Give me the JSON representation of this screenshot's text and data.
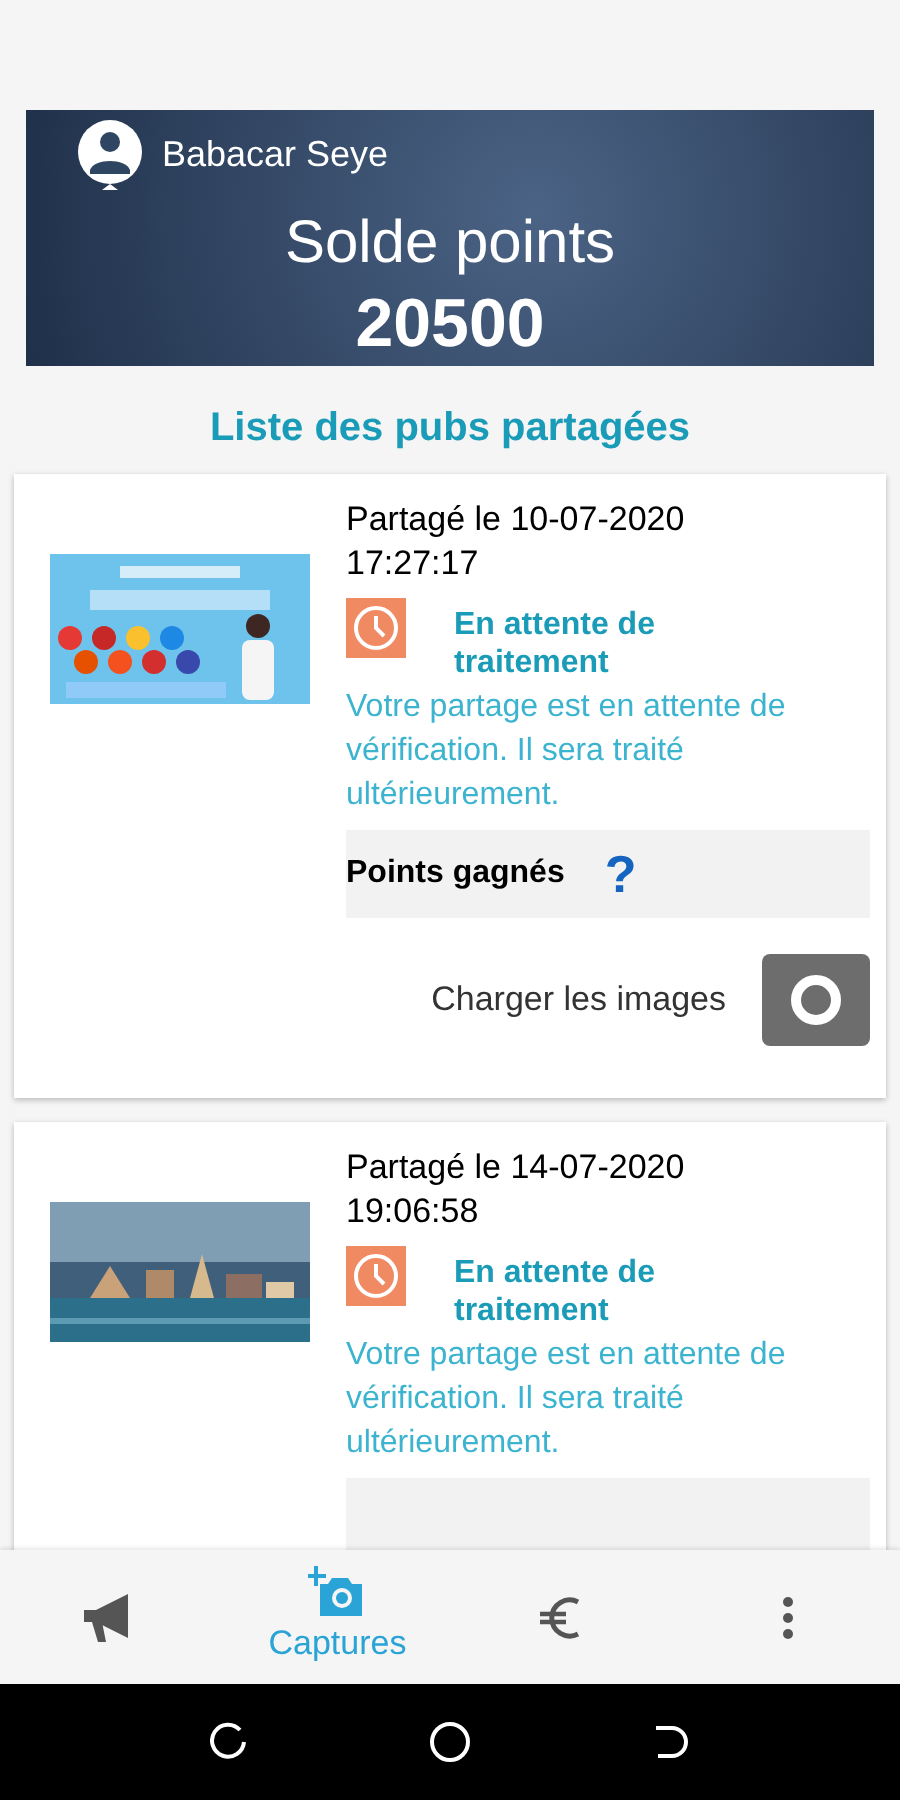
{
  "header": {
    "user_name": "Babacar Seye",
    "balance_label": "Solde points",
    "balance_value": "20500"
  },
  "list_title": "Liste des pubs partagées",
  "shares": [
    {
      "date": "Partagé le 10-07-2020",
      "time": "17:27:17",
      "status": "En attente de traitement",
      "message": "Votre partage est en attente de vérification. Il sera traité ultérieurement.",
      "points_label": "Points gagnés",
      "points_value": "?",
      "upload_label": "Charger les images"
    },
    {
      "date": "Partagé le 14-07-2020",
      "time": "19:06:58",
      "status": "En attente de traitement",
      "message": "Votre partage est en attente de vérification. Il sera traité ultérieurement."
    }
  ],
  "bottom_nav": [
    {
      "kind": "megaphone",
      "selected": false
    },
    {
      "kind": "camera",
      "label": "Captures",
      "selected": true
    },
    {
      "kind": "euro",
      "selected": false
    },
    {
      "kind": "more",
      "selected": false
    }
  ]
}
